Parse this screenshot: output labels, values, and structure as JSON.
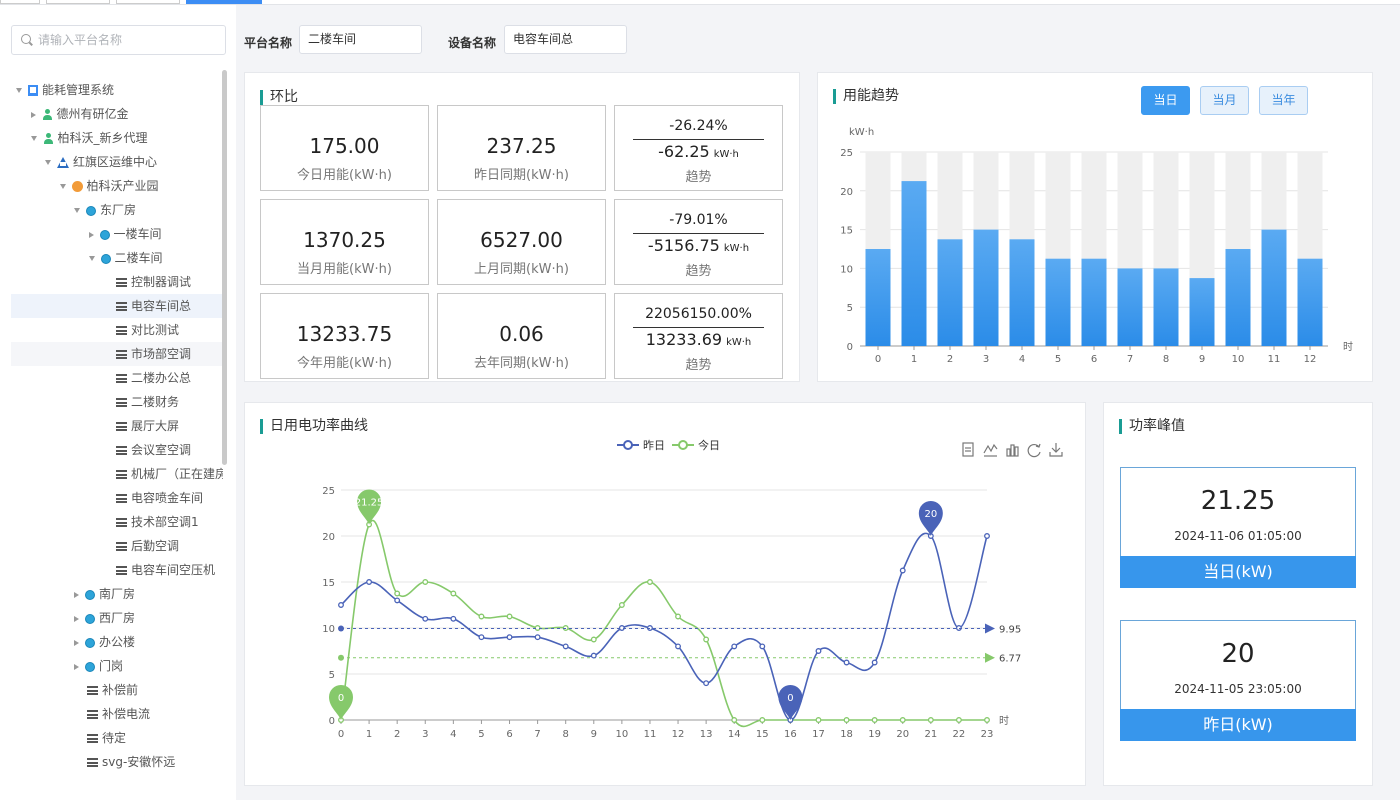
{
  "sidebar": {
    "search_placeholder": "请输入平台名称",
    "tree": [
      {
        "label": "能耗管理系统",
        "level": 0,
        "toggle": "down",
        "icon": "building-icon"
      },
      {
        "label": "德州有研亿金",
        "level": 1,
        "toggle": "right",
        "icon": "user-icon"
      },
      {
        "label": "柏科沃_新乡代理",
        "level": 1,
        "toggle": "down",
        "icon": "user-icon"
      },
      {
        "label": "红旗区运维中心",
        "level": 2,
        "toggle": "down",
        "icon": "recycle-icon"
      },
      {
        "label": "柏科沃产业园",
        "level": 3,
        "toggle": "down",
        "icon": "park-icon"
      },
      {
        "label": "东厂房",
        "level": 4,
        "toggle": "down",
        "icon": "globe-icon"
      },
      {
        "label": "一楼车间",
        "level": 5,
        "toggle": "right",
        "icon": "globe-icon"
      },
      {
        "label": "二楼车间",
        "level": 5,
        "toggle": "down",
        "icon": "globe-icon"
      },
      {
        "label": "控制器调试",
        "level": 6,
        "toggle": "none",
        "icon": "device-icon"
      },
      {
        "label": "电容车间总",
        "level": 6,
        "toggle": "none",
        "icon": "device-icon",
        "selected": true
      },
      {
        "label": "对比测试",
        "level": 6,
        "toggle": "none",
        "icon": "device-icon"
      },
      {
        "label": "市场部空调",
        "level": 6,
        "toggle": "none",
        "icon": "device-icon",
        "hover": true
      },
      {
        "label": "二楼办公总",
        "level": 6,
        "toggle": "none",
        "icon": "device-icon"
      },
      {
        "label": "二楼财务",
        "level": 6,
        "toggle": "none",
        "icon": "device-icon"
      },
      {
        "label": "展厅大屏",
        "level": 6,
        "toggle": "none",
        "icon": "device-icon"
      },
      {
        "label": "会议室空调",
        "level": 6,
        "toggle": "none",
        "icon": "device-icon"
      },
      {
        "label": "机械厂（正在建房",
        "level": 6,
        "toggle": "none",
        "icon": "device-icon"
      },
      {
        "label": "电容喷金车间",
        "level": 6,
        "toggle": "none",
        "icon": "device-icon"
      },
      {
        "label": "技术部空调1",
        "level": 6,
        "toggle": "none",
        "icon": "device-icon"
      },
      {
        "label": "后勤空调",
        "level": 6,
        "toggle": "none",
        "icon": "device-icon"
      },
      {
        "label": "电容车间空压机",
        "level": 6,
        "toggle": "none",
        "icon": "device-icon"
      },
      {
        "label": "南厂房",
        "level": 4,
        "toggle": "right",
        "icon": "globe-icon"
      },
      {
        "label": "西厂房",
        "level": 4,
        "toggle": "right",
        "icon": "globe-icon"
      },
      {
        "label": "办公楼",
        "level": 4,
        "toggle": "right",
        "icon": "globe-icon"
      },
      {
        "label": "门岗",
        "level": 4,
        "toggle": "right",
        "icon": "globe-icon"
      },
      {
        "label": "补偿前",
        "level": 4,
        "toggle": "none",
        "icon": "device-icon"
      },
      {
        "label": "补偿电流",
        "level": 4,
        "toggle": "none",
        "icon": "device-icon"
      },
      {
        "label": "待定",
        "level": 4,
        "toggle": "none",
        "icon": "device-icon"
      },
      {
        "label": "svg-安徽怀远",
        "level": 4,
        "toggle": "none",
        "icon": "device-icon"
      }
    ]
  },
  "filters": {
    "platform_label": "平台名称",
    "platform_value": "二楼车间",
    "device_label": "设备名称",
    "device_value": "电容车间总"
  },
  "hb": {
    "title": "环比",
    "rows": [
      {
        "current": "175.00",
        "current_label": "今日用能(kW·h)",
        "previous": "237.25",
        "previous_label": "昨日同期(kW·h)",
        "pct": "-26.24%",
        "abs": "-62.25",
        "unit": "kW·h",
        "trend_label": "趋势"
      },
      {
        "current": "1370.25",
        "current_label": "当月用能(kW·h)",
        "previous": "6527.00",
        "previous_label": "上月同期(kW·h)",
        "pct": "-79.01%",
        "abs": "-5156.75",
        "unit": "kW·h",
        "trend_label": "趋势"
      },
      {
        "current": "13233.75",
        "current_label": "今年用能(kW·h)",
        "previous": "0.06",
        "previous_label": "去年同期(kW·h)",
        "pct": "22056150.00%",
        "abs": "13233.69",
        "unit": "kW·h",
        "trend_label": "趋势"
      }
    ]
  },
  "trend": {
    "title": "用能趋势",
    "buttons": [
      "当日",
      "当月",
      "当年"
    ],
    "active": 0
  },
  "power_curve": {
    "title": "日用电功率曲线",
    "toolbox": [
      "data-view-icon",
      "line-type-icon",
      "bar-type-icon",
      "restore-icon",
      "save-image-icon"
    ]
  },
  "peak": {
    "title": "功率峰值",
    "cards": [
      {
        "value": "21.25",
        "time": "2024-11-06 01:05:00",
        "label": "当日(kW)"
      },
      {
        "value": "20",
        "time": "2024-11-05 23:05:00",
        "label": "昨日(kW)"
      }
    ]
  },
  "colors": {
    "accent": "#1a9c94",
    "bar": "#2b8ce8",
    "bar_bg": "#efefef",
    "yesterday": "#4a63b8",
    "today": "#86c96b",
    "peak_band": "#3796ec"
  },
  "chart_data": [
    {
      "type": "bar",
      "ylabel": "kW·h",
      "xlabel": "时",
      "ylim": [
        0,
        25
      ],
      "y_ticks": [
        0,
        5,
        10,
        15,
        20,
        25
      ],
      "categories": [
        "0",
        "1",
        "2",
        "3",
        "4",
        "5",
        "6",
        "7",
        "8",
        "9",
        "10",
        "11",
        "12"
      ],
      "values": [
        12.5,
        21.25,
        13.75,
        15,
        13.75,
        11.25,
        11.25,
        10,
        10,
        8.75,
        12.5,
        15,
        11.25
      ],
      "background_max": 25,
      "grid": true
    },
    {
      "type": "line",
      "xlabel": "时",
      "ylim": [
        0,
        25
      ],
      "y_ticks": [
        0,
        5,
        10,
        15,
        20,
        25
      ],
      "x": [
        "0",
        "1",
        "2",
        "3",
        "4",
        "5",
        "6",
        "7",
        "8",
        "9",
        "10",
        "11",
        "12",
        "13",
        "14",
        "15",
        "16",
        "17",
        "18",
        "19",
        "20",
        "21",
        "22",
        "23"
      ],
      "legend": "top-center",
      "grid": true,
      "series": [
        {
          "name": "昨日",
          "values": [
            12.5,
            15,
            13,
            11,
            11,
            9,
            9,
            9,
            8,
            7,
            10,
            10,
            8,
            4,
            8,
            8,
            0,
            7.5,
            6.25,
            6.25,
            16.25,
            20,
            10,
            20
          ],
          "max_label": "20",
          "max_index": 21,
          "min_label": "0",
          "min_index": 16,
          "avg_label": "9.95",
          "avg": 9.95
        },
        {
          "name": "今日",
          "values": [
            0,
            21.25,
            13.75,
            15,
            13.75,
            11.25,
            11.25,
            10,
            10,
            8.75,
            12.5,
            15,
            11.25,
            8.75,
            0,
            0,
            0,
            0,
            0,
            0,
            0,
            0,
            0,
            0
          ],
          "max_label": "21.25",
          "max_index": 1,
          "min_label": "0",
          "min_index": 0,
          "avg_label": "6.77",
          "avg": 6.77
        }
      ]
    }
  ]
}
